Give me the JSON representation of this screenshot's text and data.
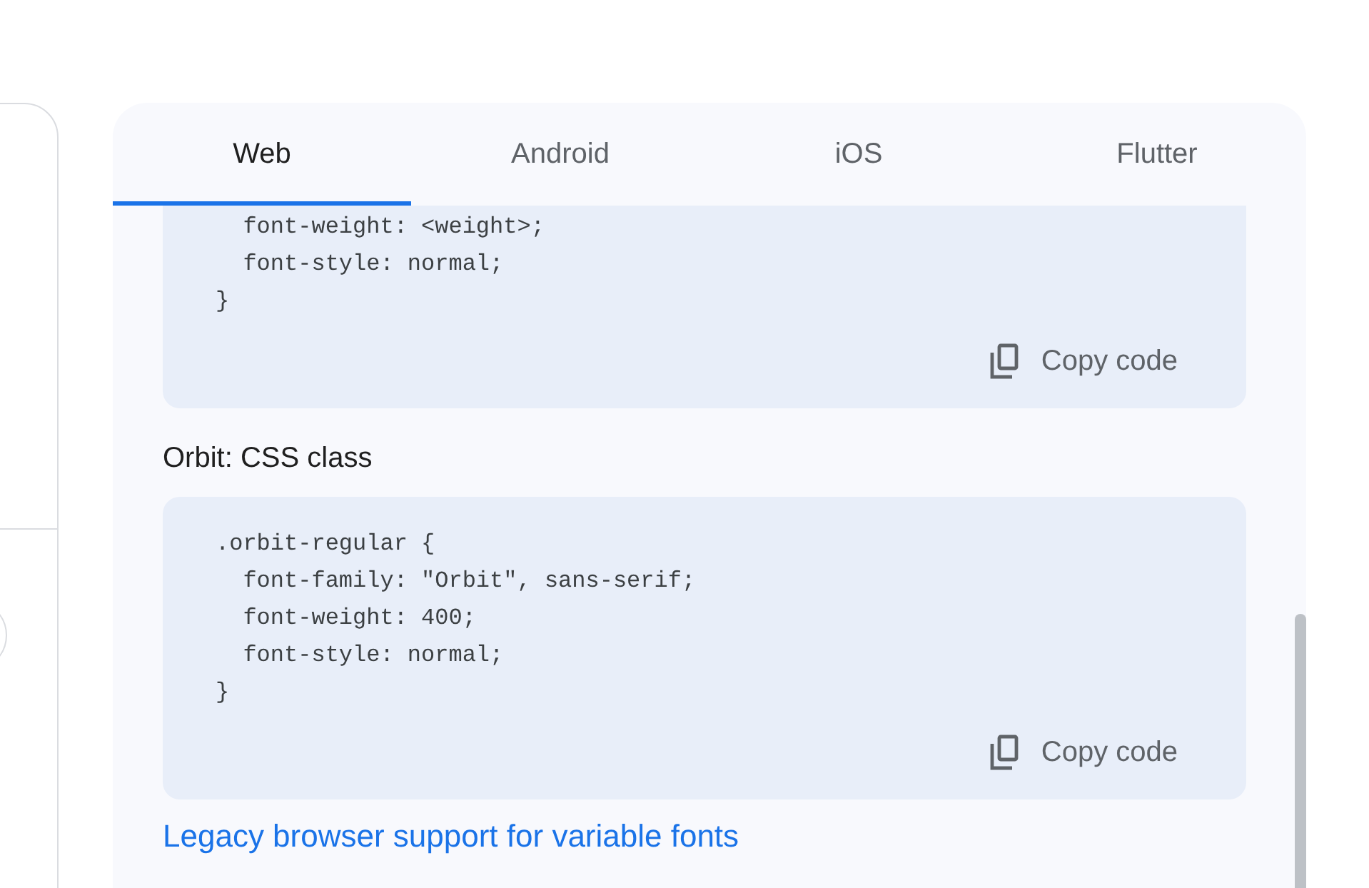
{
  "tabs": [
    {
      "label": "Web",
      "selected": true
    },
    {
      "label": "Android",
      "selected": false
    },
    {
      "label": "iOS",
      "selected": false
    },
    {
      "label": "Flutter",
      "selected": false
    }
  ],
  "content": [
    {
      "kind": "code_block",
      "lines": [
        "  font-weight: <weight>;",
        "  font-style: normal;",
        "}"
      ],
      "copy_button": "Copy code"
    },
    {
      "kind": "heading",
      "text": "Orbit: CSS class"
    },
    {
      "kind": "code_block",
      "lines": [
        ".orbit-regular {",
        "  font-family: \"Orbit\", sans-serif;",
        "  font-weight: 400;",
        "  font-style: normal;",
        "}"
      ],
      "copy_button": "Copy code"
    },
    {
      "kind": "link",
      "text": "Legacy browser support for variable fonts"
    }
  ]
}
